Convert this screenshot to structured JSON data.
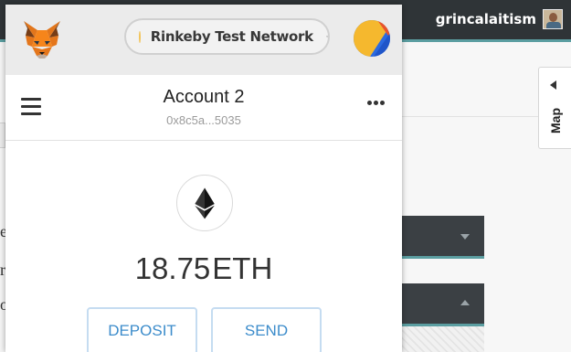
{
  "background_page": {
    "username": "grincalaitism",
    "map_tab_label": "Map",
    "left_edge_glyphs": [
      "e",
      "r",
      "o"
    ]
  },
  "wallet": {
    "network": {
      "label": "Rinkeby Test Network",
      "status_color": "#f2c45a"
    },
    "account": {
      "name": "Account 2",
      "address": "0x8c5a...5035"
    },
    "balance": {
      "amount": "18.75",
      "currency": "ETH"
    },
    "buttons": {
      "deposit": "DEPOSIT",
      "send": "SEND"
    },
    "icons": {
      "logo": "metamask-fox-icon",
      "menu": "hamburger-icon",
      "more": "more-options-icon",
      "token": "ethereum-icon",
      "network_toggle": "chevron-down-icon",
      "identicon": "account-identicon"
    },
    "colors": {
      "header_bg": "#ebebeb",
      "button_text": "#3c8ccb",
      "button_border": "#c5dcf1"
    }
  }
}
